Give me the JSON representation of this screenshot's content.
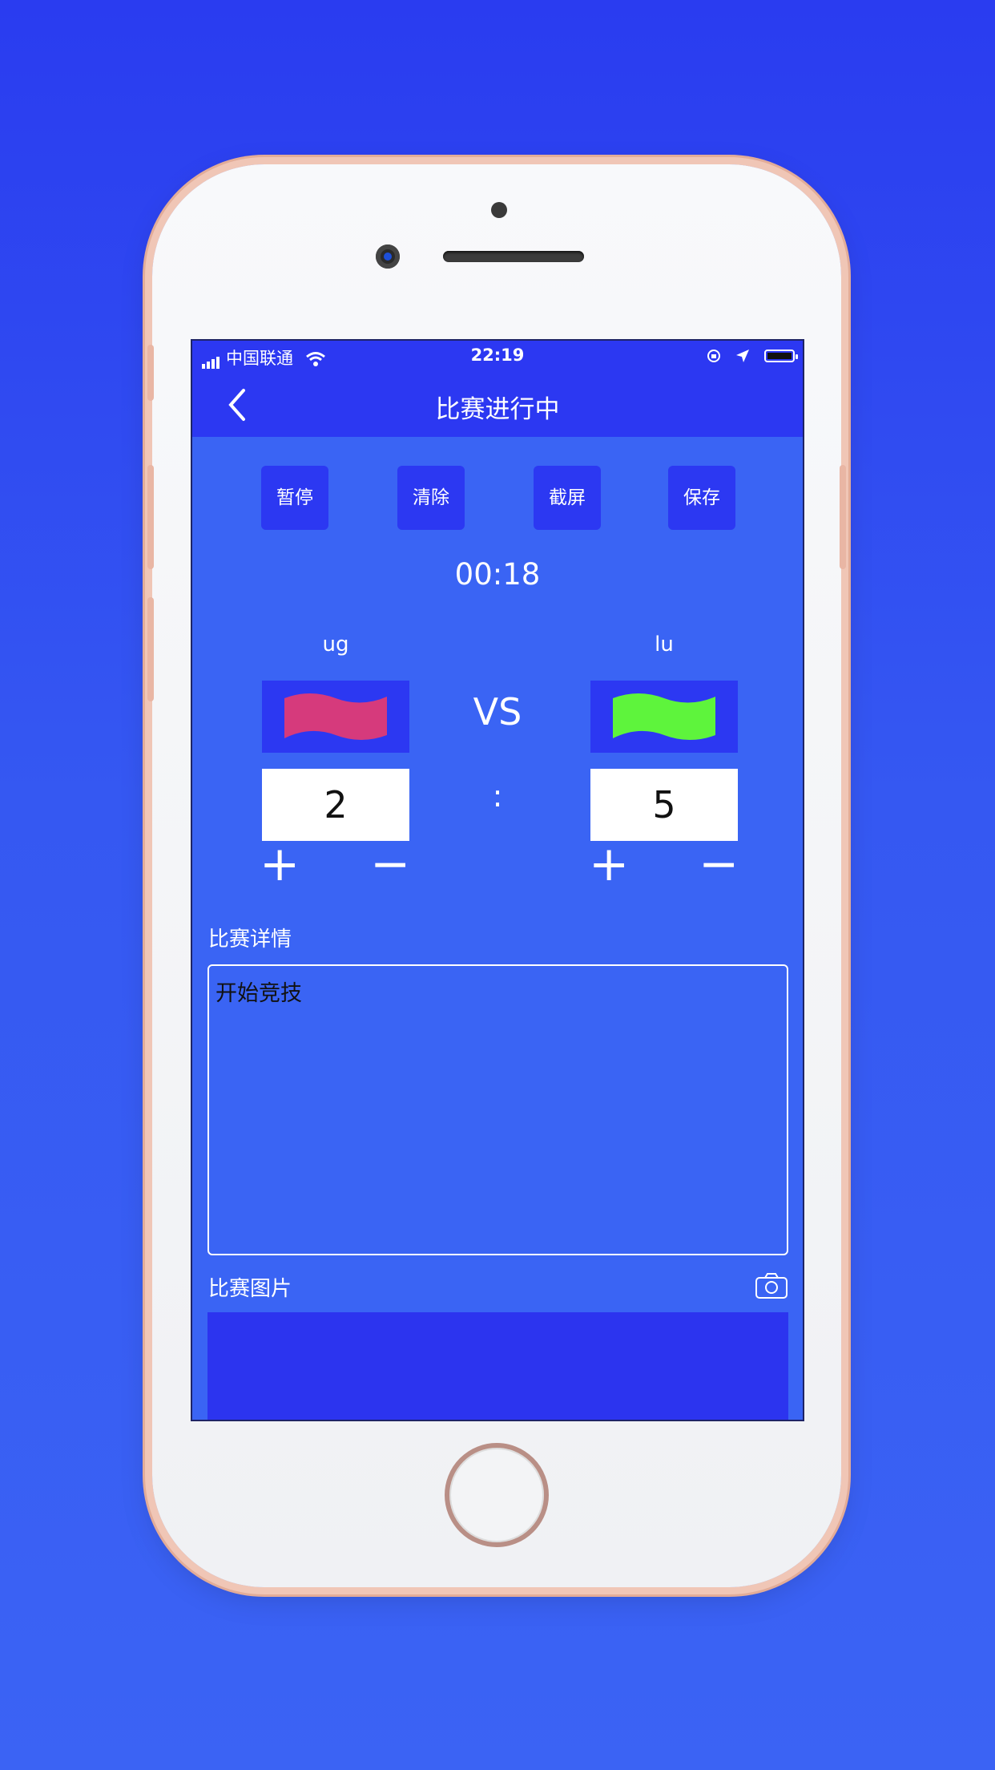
{
  "status_bar": {
    "carrier": "中国联通",
    "time": "22:19"
  },
  "nav": {
    "back_icon": "chevron-left-icon",
    "title": "比赛进行中"
  },
  "actions": {
    "pause": "暂停",
    "clear": "清除",
    "screenshot": "截屏",
    "save": "保存"
  },
  "timer": "00:18",
  "teams": {
    "left": {
      "name": "ug",
      "flag_color": "#d63a7c",
      "score": "2"
    },
    "right": {
      "name": "lu",
      "flag_color": "#5ef43c",
      "score": "5"
    }
  },
  "vs_label": "VS",
  "score_separator": ":",
  "controls": {
    "plus": "+",
    "minus": "−"
  },
  "details": {
    "label": "比赛详情",
    "text": "开始竞技"
  },
  "photos": {
    "label": "比赛图片",
    "camera_icon": "camera-icon"
  },
  "colors": {
    "background": "#3558f2",
    "nav_bar": "#2c38f2",
    "screen": "#3a64f4"
  }
}
